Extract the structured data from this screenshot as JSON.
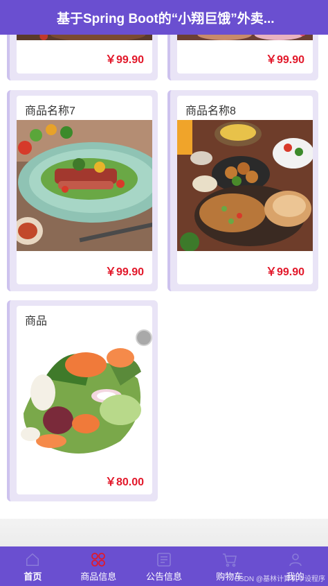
{
  "header": {
    "title": "基于Spring Boot的“小翔巨饿”外卖..."
  },
  "products": [
    {
      "name": "",
      "price": "￥99.90"
    },
    {
      "name": "",
      "price": "￥99.90"
    },
    {
      "name": "商品名称7",
      "price": "￥99.90"
    },
    {
      "name": "商品名称8",
      "price": "￥99.90"
    },
    {
      "name": "商品",
      "price": "￥80.00"
    }
  ],
  "tabbar": {
    "tabs": [
      {
        "label": "首页",
        "icon": "home-icon"
      },
      {
        "label": "商品信息",
        "icon": "grid-icon"
      },
      {
        "label": "公告信息",
        "icon": "notice-icon"
      },
      {
        "label": "购物车",
        "icon": "cart-icon"
      },
      {
        "label": "我的",
        "icon": "user-icon"
      }
    ]
  },
  "watermark": "CSDN @基林计算机毕设程序",
  "colors": {
    "accent": "#6a4fd0",
    "price": "#e2182a",
    "card_bg": "#e9e4f6"
  }
}
